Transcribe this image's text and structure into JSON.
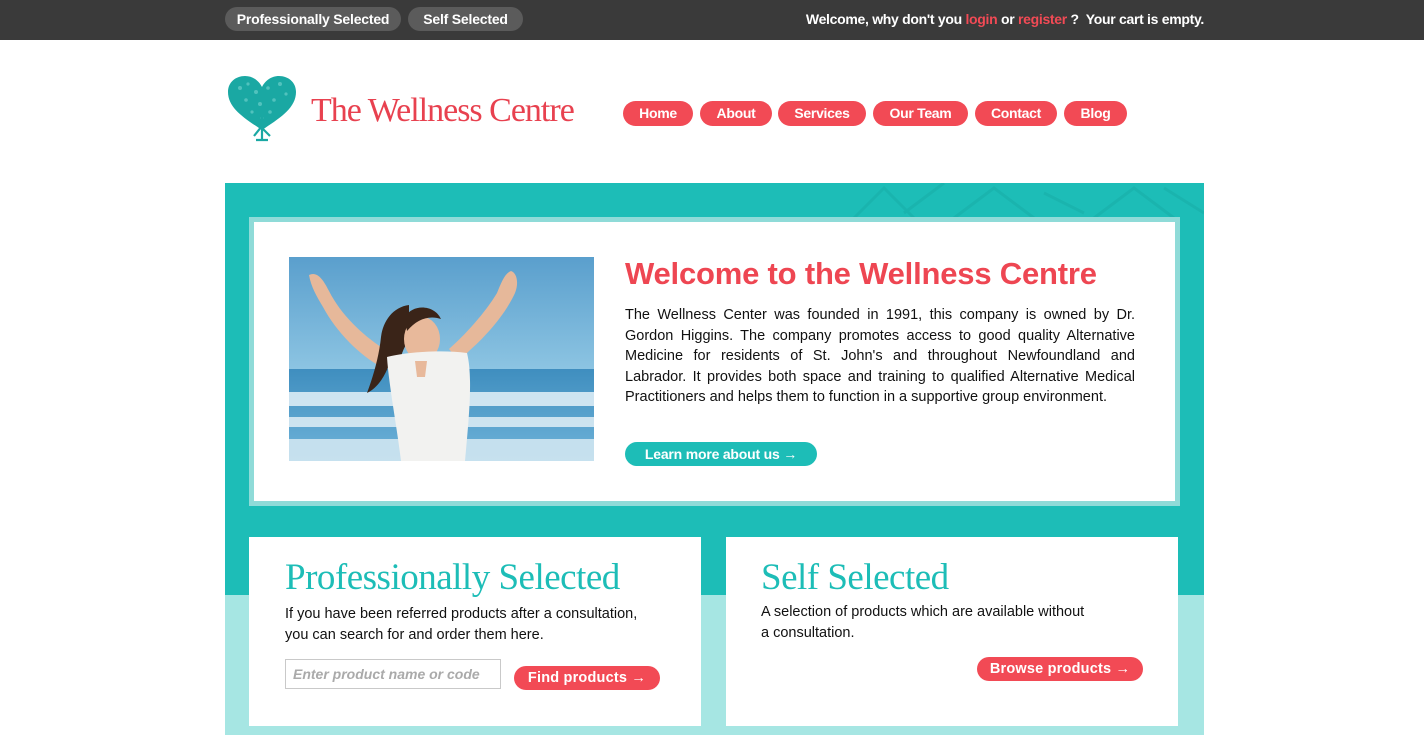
{
  "topbar": {
    "tabs": [
      "Professionally Selected",
      "Self Selected"
    ],
    "welcome_prefix": "Welcome, why don't you",
    "login_label": "login",
    "or_label": "or",
    "register_label": "register",
    "question": "?",
    "cart_status": "Your cart is empty."
  },
  "logo": {
    "text": "The Wellness Centre"
  },
  "nav": [
    "Home",
    "About",
    "Services",
    "Our Team",
    "Contact",
    "Blog"
  ],
  "hero": {
    "title": "Welcome to the Wellness Centre",
    "body": "The Wellness Center was founded in 1991, this company is owned by Dr. Gordon Higgins. The company promotes access to good quality Alternative Medicine for residents of St. John's and throughout  Newfoundland and Labrador. It provides both space and training to qualified Alternative Medical Practitioners and helps them to function in a supportive group environment.",
    "button_label": "Learn more about us →"
  },
  "professional": {
    "title": "Professionally Selected",
    "line1": "If you have been referred products after a consultation,",
    "line2": "you can search for and order them here.",
    "search_placeholder": "Enter product name or code",
    "button_label": "Find products →"
  },
  "self": {
    "title": "Self Selected",
    "line1": "A selection of products which are available without",
    "line2": "a consultation.",
    "button_label": "Browse products →"
  },
  "colors": {
    "accent_red": "#f24a55",
    "teal": "#1dbdb7",
    "light_teal": "#a6e6e3",
    "topbar": "#3a3a3a"
  }
}
